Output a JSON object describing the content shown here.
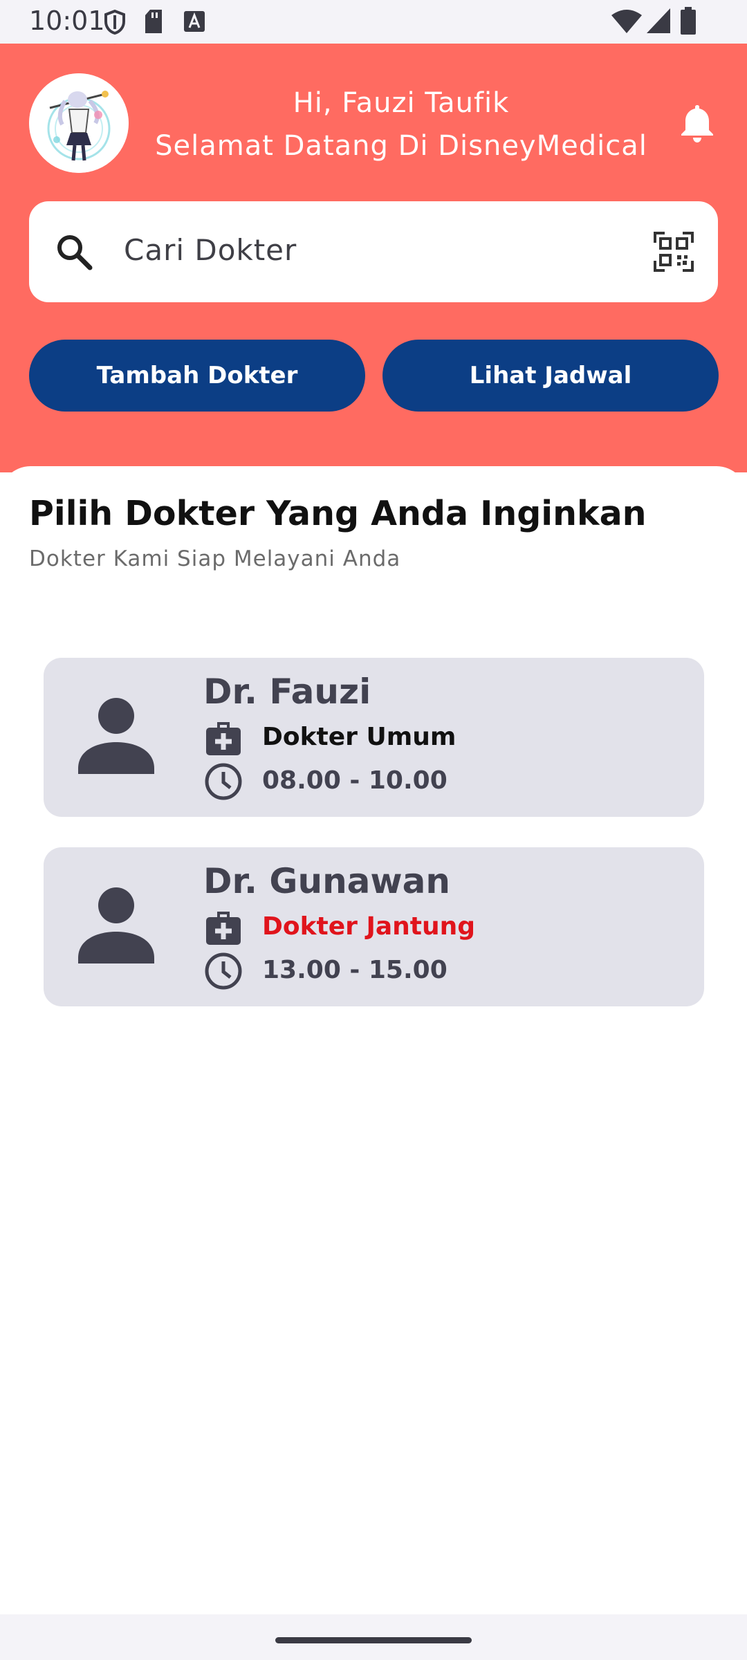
{
  "status_bar": {
    "time": "10:01",
    "icons": [
      "shield-icon",
      "sd-card-icon",
      "font-icon",
      "wifi-icon",
      "signal-icon",
      "battery-icon"
    ]
  },
  "header": {
    "greeting_line1": "Hi, Fauzi Taufik",
    "greeting_line2": "Selamat Datang Di DisneyMedical",
    "background_color": "#ff6b61"
  },
  "search": {
    "placeholder": "Cari Dokter"
  },
  "actions": {
    "add_doctor": "Tambah Dokter",
    "view_schedule": "Lihat Jadwal",
    "button_color": "#0c3e85"
  },
  "section": {
    "title": "Pilih Dokter Yang Anda Inginkan",
    "subtitle": "Dokter Kami Siap Melayani Anda"
  },
  "doctors": [
    {
      "name": "Dr. Fauzi",
      "specialty": "Dokter Umum",
      "specialty_color": "#111111",
      "hours": "08.00 - 10.00"
    },
    {
      "name": "Dr. Gunawan",
      "specialty": "Dokter Jantung",
      "specialty_color": "#e0141c",
      "hours": "13.00 - 15.00"
    }
  ]
}
